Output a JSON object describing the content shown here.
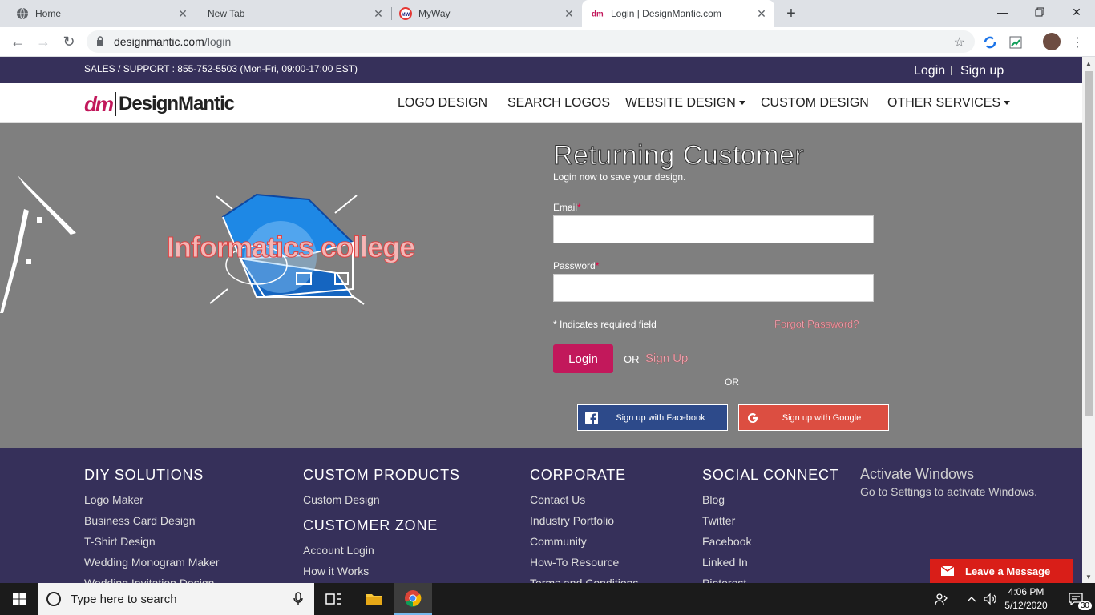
{
  "browser": {
    "tabs": [
      {
        "title": "Home",
        "icon": "globe-icon",
        "active": false
      },
      {
        "title": "New Tab",
        "icon": "",
        "active": false
      },
      {
        "title": "MyWay",
        "icon": "myway-icon",
        "active": false
      },
      {
        "title": "Login | DesignMantic.com",
        "icon": "designmantic-icon",
        "active": true
      }
    ],
    "new_tab_symbol": "+",
    "url_host": "designmantic.com",
    "url_path": "/login"
  },
  "topstrip": {
    "support": "SALES / SUPPORT : 855-752-5503 (Mon-Fri, 09:00-17:00 EST)",
    "login": "Login",
    "signup": "Sign up"
  },
  "navbar": {
    "logo_mark": "dm",
    "logo_word": "DesignMantic",
    "items": [
      "LOGO DESIGN",
      "SEARCH LOGOS",
      "WEBSITE DESIGN",
      "CUSTOM DESIGN",
      "OTHER SERVICES"
    ]
  },
  "hero": {
    "logo_text": "Informatics college"
  },
  "form": {
    "title": "Returning Customer",
    "subtitle": "Login now to save your design.",
    "email_label": "Email",
    "password_label": "Password",
    "required_mark": "*",
    "required_note": "* Indicates required field",
    "forgot": "Forgot Password?",
    "login_button": "Login",
    "or_inline": "OR",
    "signup_link": "Sign Up",
    "or_center": "OR",
    "facebook_button": "Sign up with Facebook",
    "google_button": "Sign up with Google"
  },
  "footer": {
    "columns": [
      {
        "heading": "DIY SOLUTIONS",
        "links": [
          "Logo Maker",
          "Business Card Design",
          "T-Shirt Design",
          "Wedding Monogram Maker",
          "Wedding Invitation Design"
        ]
      },
      {
        "heading": "CUSTOM PRODUCTS",
        "links": [
          "Custom Design"
        ]
      },
      {
        "heading": "CUSTOMER ZONE",
        "links": [
          "Account Login",
          "How it Works"
        ]
      },
      {
        "heading": "CORPORATE",
        "links": [
          "Contact Us",
          "Industry Portfolio",
          "Community",
          "How-To Resource",
          "Terms and Conditions"
        ]
      },
      {
        "heading": "SOCIAL CONNECT",
        "links": [
          "Blog",
          "Twitter",
          "Facebook",
          "Linked In",
          "Pinterest"
        ]
      }
    ],
    "activate_title": "Activate Windows",
    "activate_sub": "Go to Settings to activate Windows.",
    "chat": "Leave a Message"
  },
  "taskbar": {
    "search_placeholder": "Type here to search",
    "time": "4:06 PM",
    "date": "5/12/2020",
    "notifications": "30"
  },
  "colors": {
    "brand_pink": "#c2185b",
    "strip_purple": "#36305a",
    "facebook": "#2d4a8a",
    "google": "#dc4e41"
  }
}
